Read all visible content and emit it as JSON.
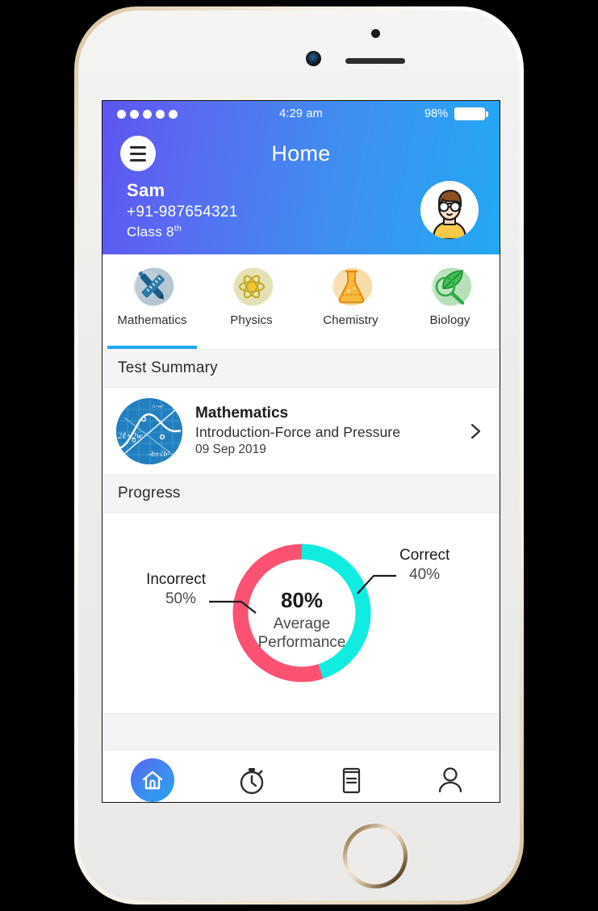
{
  "status_bar": {
    "signal_dots": 5,
    "time": "4:29 am",
    "battery_percent": "98%"
  },
  "header": {
    "title": "Home",
    "menu_icon": "hamburger-menu-icon",
    "avatar_icon": "user-avatar",
    "user": {
      "name": "Sam",
      "phone": "+91-987654321",
      "class_prefix": "Class 8",
      "class_suffix": "th"
    },
    "gradient_from": "#5d55f0",
    "gradient_to": "#23a9f2"
  },
  "subjects": {
    "active_index": 0,
    "active_underline_color": "#21a7f0",
    "items": [
      {
        "label": "Mathematics",
        "icon": "ruler-pen-icon",
        "blob_color": "#a9bdcd",
        "accent": "#1b5d86"
      },
      {
        "label": "Physics",
        "icon": "atom-icon",
        "blob_color": "#dcd9a4",
        "accent": "#c4a81e"
      },
      {
        "label": "Chemistry",
        "icon": "flask-icon",
        "blob_color": "#f5d79a",
        "accent": "#e8a022"
      },
      {
        "label": "Biology",
        "icon": "leaf-magnifier-icon",
        "blob_color": "#a9dcab",
        "accent": "#2faa46"
      }
    ]
  },
  "test_summary": {
    "section_title": "Test Summary",
    "thumbnail_icon": "math-formula-thumbnail",
    "subject": "Mathematics",
    "topic": "Introduction-Force and Pressure",
    "date": "09 Sep 2019",
    "chevron_icon": "chevron-right-icon"
  },
  "progress": {
    "section_title": "Progress"
  },
  "chart_data": {
    "type": "pie",
    "title": "Progress",
    "center_value": "80%",
    "center_label_line1": "Average",
    "center_label_line2": "Performance",
    "legend_position": "callout-labels",
    "slices": [
      {
        "name": "Correct",
        "value": 40,
        "display": "40%",
        "color": "#10ece0",
        "start_deg": 0,
        "sweep_deg": 162
      },
      {
        "name": "Incorrect",
        "value": 50,
        "display": "50%",
        "color": "#fb5273",
        "start_deg": 162,
        "sweep_deg": 198
      }
    ]
  },
  "bottom_nav": {
    "active_index": 0,
    "items": [
      {
        "icon": "home-icon",
        "name": "home"
      },
      {
        "icon": "stopwatch-icon",
        "name": "timer"
      },
      {
        "icon": "document-icon",
        "name": "notes"
      },
      {
        "icon": "person-icon",
        "name": "profile"
      }
    ]
  }
}
